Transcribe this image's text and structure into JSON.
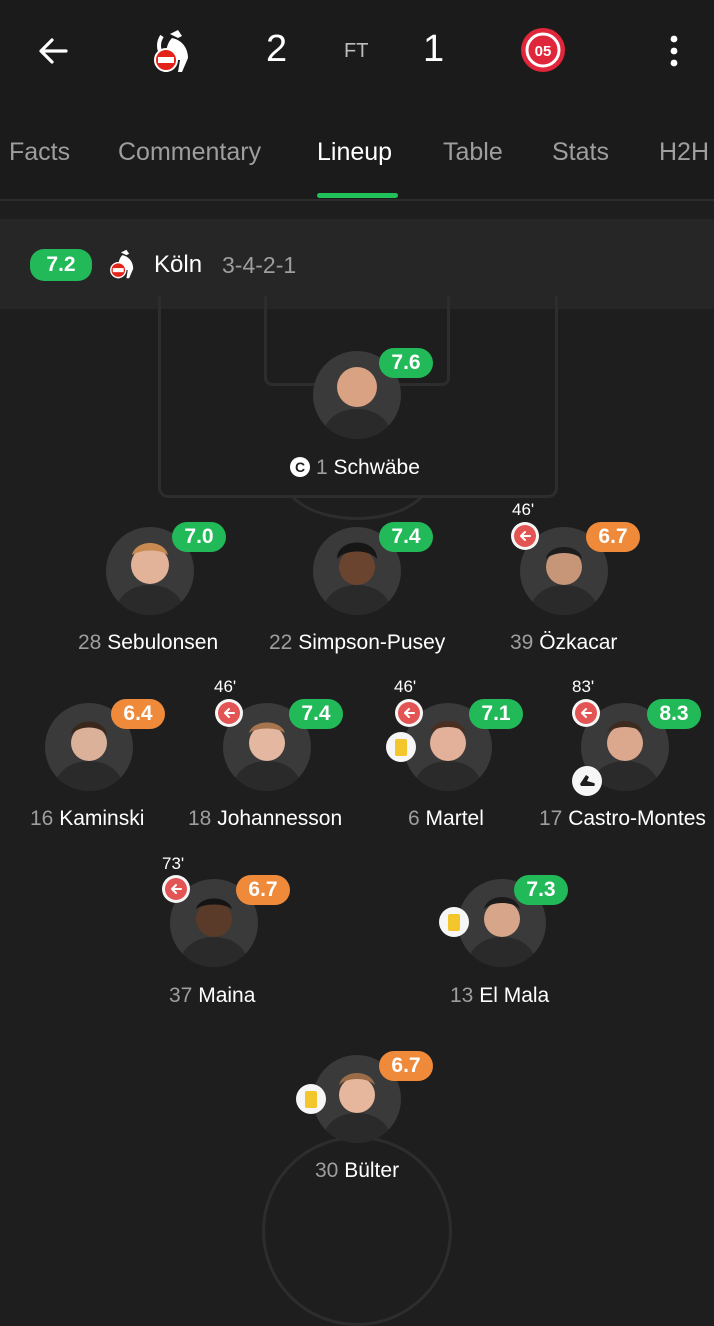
{
  "header": {
    "home_score": "2",
    "status": "FT",
    "away_score": "1",
    "home_logo_icon": "koln-crest-icon",
    "away_logo_icon": "mainz-crest-icon"
  },
  "tabs": [
    {
      "label": "Facts"
    },
    {
      "label": "Commentary"
    },
    {
      "label": "Lineup"
    },
    {
      "label": "Table"
    },
    {
      "label": "Stats"
    },
    {
      "label": "H2H"
    }
  ],
  "active_tab": "Lineup",
  "team": {
    "rating": "7.2",
    "name": "Köln",
    "formation": "3-4-2-1"
  },
  "colors": {
    "rating_green": "#22b958",
    "rating_orange": "#ee8a3a",
    "tab_accent": "#21c15a",
    "sub_red": "#e35555",
    "yellow_card": "#f3c62b"
  },
  "players": [
    {
      "number": "1",
      "name": "Schwäbe",
      "rating": "7.6",
      "rating_level": "green",
      "captain": true,
      "captain_mark": "C"
    },
    {
      "number": "28",
      "name": "Sebulonsen",
      "rating": "7.0",
      "rating_level": "green"
    },
    {
      "number": "22",
      "name": "Simpson-Pusey",
      "rating": "7.4",
      "rating_level": "green"
    },
    {
      "number": "39",
      "name": "Özkacar",
      "rating": "6.7",
      "rating_level": "orange",
      "sub_minute": "46'"
    },
    {
      "number": "16",
      "name": "Kaminski",
      "rating": "6.4",
      "rating_level": "orange"
    },
    {
      "number": "18",
      "name": "Johannesson",
      "rating": "7.4",
      "rating_level": "green",
      "sub_minute": "46'"
    },
    {
      "number": "6",
      "name": "Martel",
      "rating": "7.1",
      "rating_level": "green",
      "sub_minute": "46'",
      "yellow_card": true
    },
    {
      "number": "17",
      "name": "Castro-Montes",
      "rating": "8.3",
      "rating_level": "green",
      "sub_minute": "83'",
      "assist": true
    },
    {
      "number": "37",
      "name": "Maina",
      "rating": "6.7",
      "rating_level": "orange",
      "sub_minute": "73'"
    },
    {
      "number": "13",
      "name": "El Mala",
      "rating": "7.3",
      "rating_level": "green",
      "yellow_card": true
    },
    {
      "number": "30",
      "name": "Bülter",
      "rating": "6.7",
      "rating_level": "orange",
      "yellow_card": true
    }
  ]
}
